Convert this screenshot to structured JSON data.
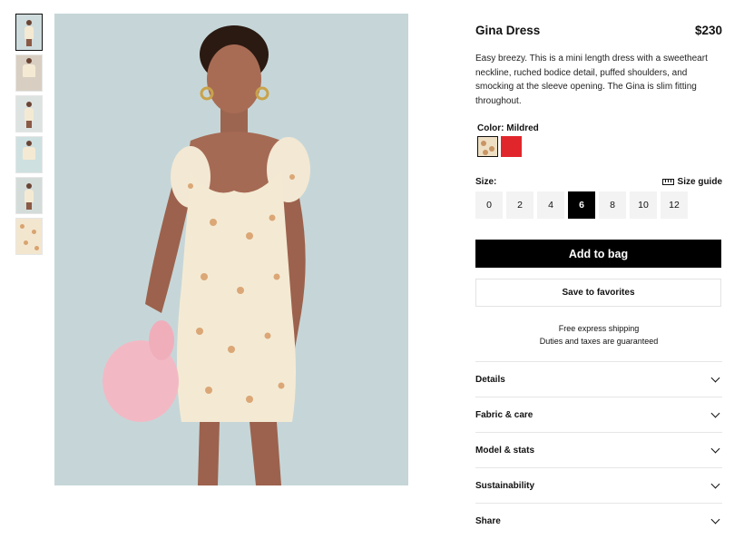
{
  "product": {
    "title": "Gina Dress",
    "price": "$230",
    "description": "Easy breezy. This is a mini length dress with a sweetheart neckline, ruched bodice detail, puffed shoulders, and smocking at the sleeve opening. The Gina is slim fitting throughout."
  },
  "color": {
    "label": "Color:",
    "selected": "Mildred",
    "swatches": [
      {
        "name": "floral-swatch",
        "hex": "#eedfc4"
      },
      {
        "name": "red-swatch",
        "hex": "#e0262b"
      }
    ]
  },
  "size": {
    "label": "Size:",
    "guide_label": "Size guide",
    "options": [
      "0",
      "2",
      "4",
      "6",
      "8",
      "10",
      "12"
    ],
    "selected": "6"
  },
  "actions": {
    "add_to_bag": "Add to bag",
    "save_to_favorites": "Save to favorites"
  },
  "shipping": {
    "line1": "Free express shipping",
    "line2": "Duties and taxes are guaranteed"
  },
  "accordion": [
    "Details",
    "Fabric & care",
    "Model & stats",
    "Sustainability",
    "Share"
  ],
  "thumbnails": {
    "count": 6,
    "active_index": 0
  },
  "colors": {
    "background": "#ffffff",
    "primary_button": "#000000",
    "photo_backdrop": "#c9d8da"
  }
}
